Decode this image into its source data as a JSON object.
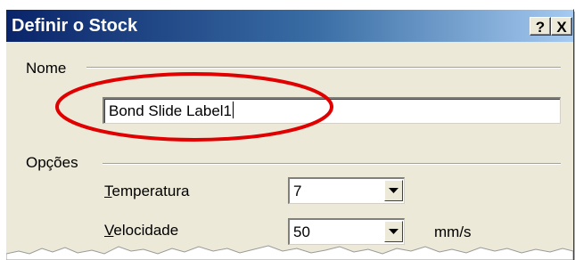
{
  "window": {
    "title": "Definir o Stock",
    "help_label": "?",
    "close_label": "X"
  },
  "nome_group": {
    "label": "Nome",
    "name_value": "Bond Slide Label1"
  },
  "opcoes_group": {
    "label": "Opções",
    "temperatura": {
      "label_first": "T",
      "label_rest": "emperatura",
      "value": "7"
    },
    "velocidade": {
      "label_first": "V",
      "label_rest": "elocidade",
      "value": "50",
      "unit": "mm/s"
    }
  },
  "colors": {
    "highlight_ellipse": "#e00000",
    "titlebar_start": "#0a246a",
    "titlebar_end": "#a6caf0",
    "dialog_face": "#ece9d8"
  },
  "icons": {
    "dropdown": "chevron-down-icon"
  }
}
